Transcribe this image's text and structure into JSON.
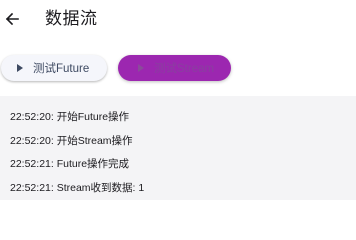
{
  "app_bar": {
    "title": "数据流",
    "back_icon": "arrow-left-icon"
  },
  "buttons": {
    "future": {
      "label": "测试Future",
      "icon": "play-icon",
      "bg_color": "#f5f6fb",
      "text_color": "#3e4a62"
    },
    "stream": {
      "label": "测试Stream",
      "icon": "play-icon",
      "bg_color": "#9c27b0",
      "text_color": "#8a3fa0"
    }
  },
  "log": {
    "bg_color": "#f4f4f6",
    "lines": [
      "22:52:20: 开始Future操作",
      "22:52:20: 开始Stream操作",
      "22:52:21: Future操作完成",
      "22:52:21: Stream收到数据: 1"
    ]
  }
}
